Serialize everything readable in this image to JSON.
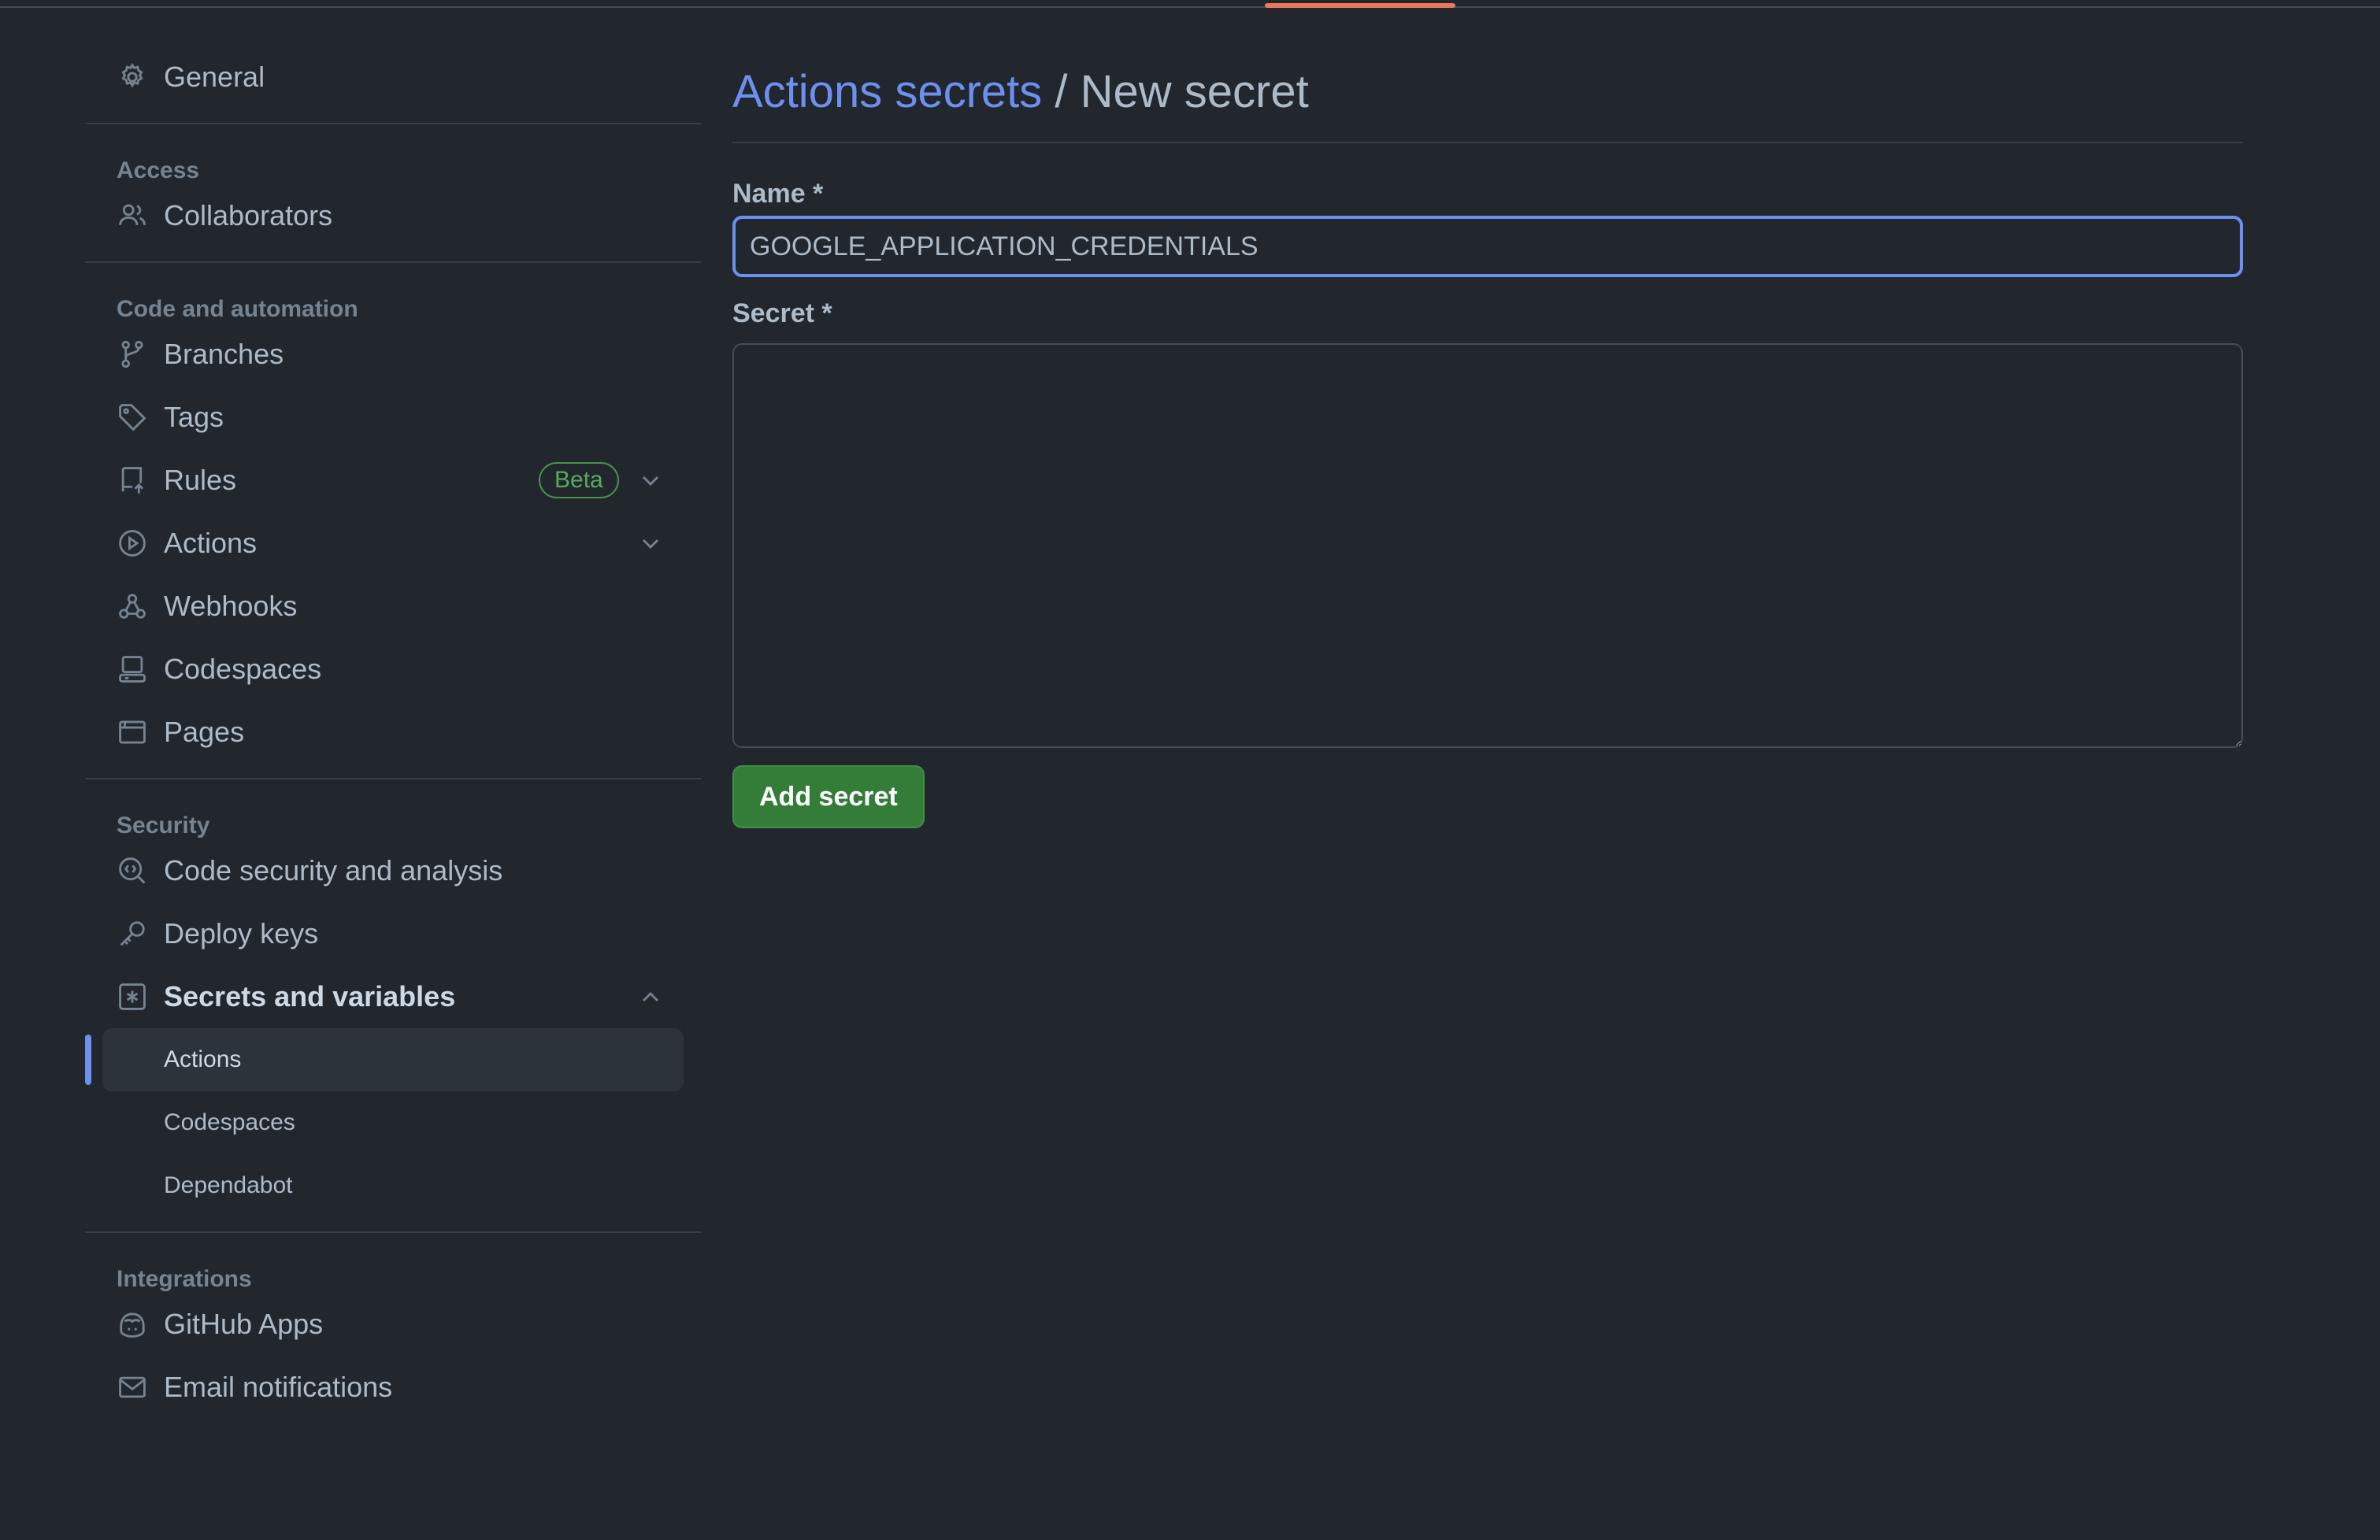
{
  "sidebar": {
    "general": "General",
    "access": {
      "heading": "Access",
      "collaborators": "Collaborators"
    },
    "code_automation": {
      "heading": "Code and automation",
      "branches": "Branches",
      "tags": "Tags",
      "rules": "Rules",
      "rules_badge": "Beta",
      "actions": "Actions",
      "webhooks": "Webhooks",
      "codespaces": "Codespaces",
      "pages": "Pages"
    },
    "security": {
      "heading": "Security",
      "code_security": "Code security and analysis",
      "deploy_keys": "Deploy keys",
      "secrets_variables": "Secrets and variables",
      "sub": {
        "actions": "Actions",
        "codespaces": "Codespaces",
        "dependabot": "Dependabot"
      }
    },
    "integrations": {
      "heading": "Integrations",
      "github_apps": "GitHub Apps",
      "email_notifications": "Email notifications"
    }
  },
  "main": {
    "breadcrumb_link": "Actions secrets",
    "breadcrumb_sep": "/",
    "breadcrumb_current": "New secret",
    "name_label": "Name *",
    "name_value": "GOOGLE_APPLICATION_CREDENTIALS",
    "secret_label": "Secret *",
    "secret_value": "",
    "submit_label": "Add secret"
  },
  "colors": {
    "background": "#22272e",
    "accent": "#6c8ff0",
    "success": "#347d39",
    "badge_green": "#57ab5a",
    "top_tab_underline": "#ec775c"
  }
}
